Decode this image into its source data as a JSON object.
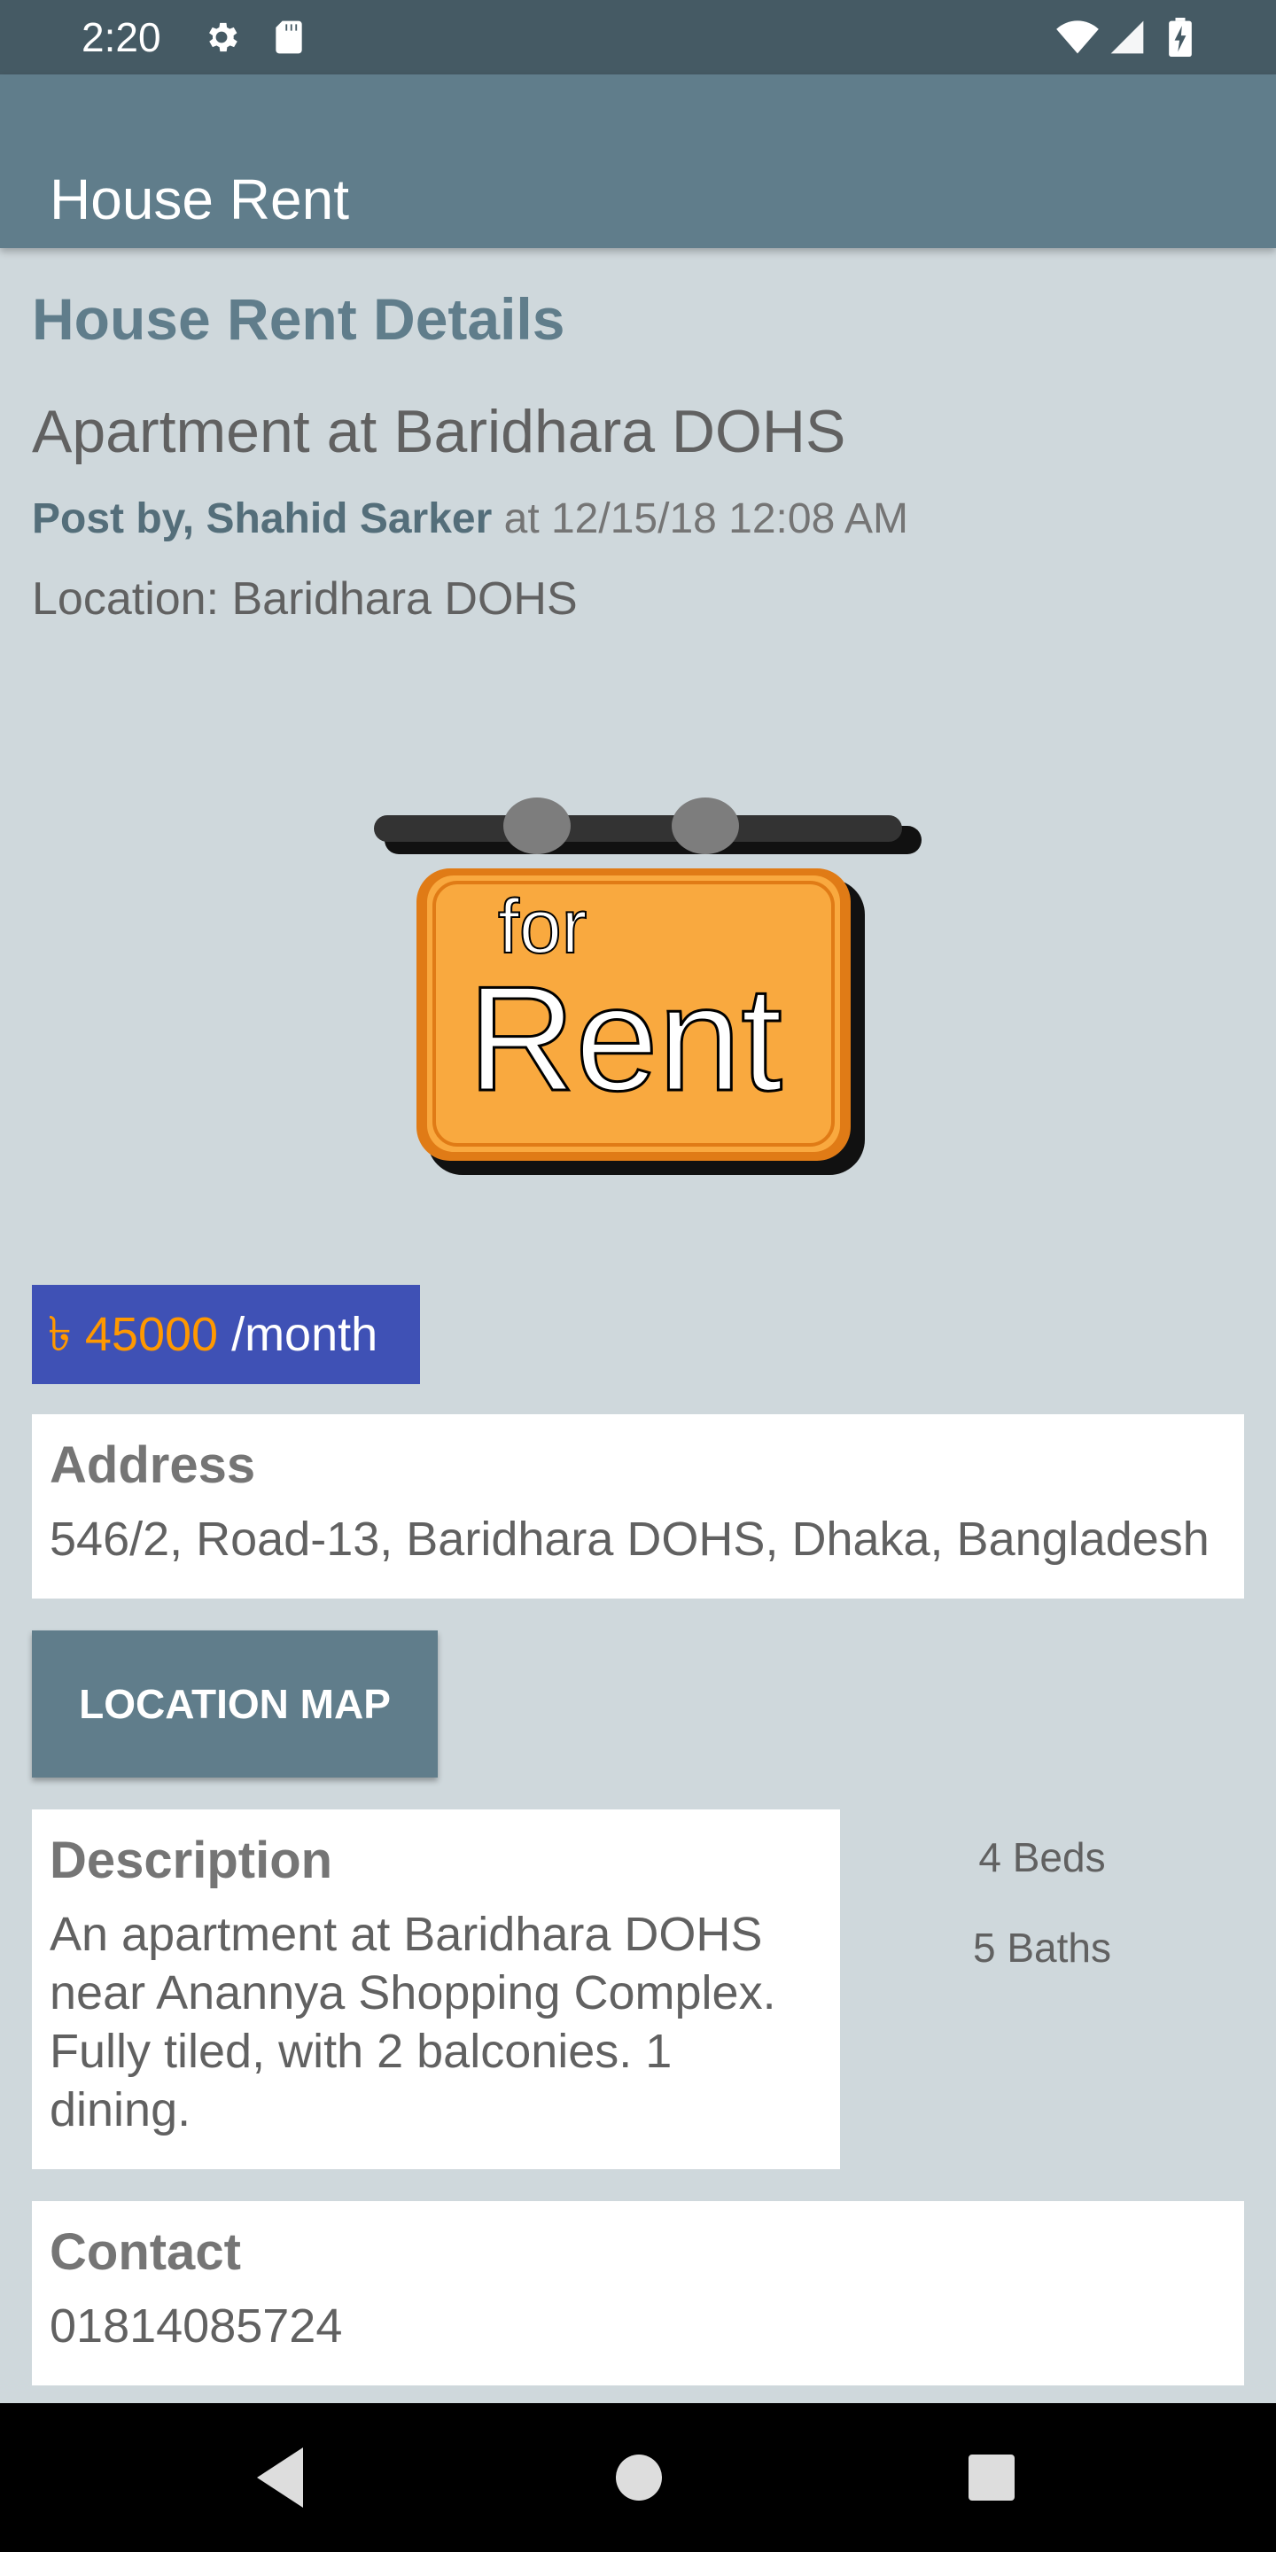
{
  "status_bar": {
    "time": "2:20",
    "icons": [
      "gear-icon",
      "sd-card-icon",
      "wifi-icon",
      "cell-signal-icon",
      "battery-charging-icon"
    ]
  },
  "app_bar": {
    "title": "House Rent"
  },
  "details": {
    "section_title": "House Rent Details",
    "title": "Apartment at Baridhara DOHS",
    "posted_by_label": "Post by, Shahid Sarker",
    "posted_at": " at 12/15/18 12:08 AM",
    "location": "Location: Baridhara DOHS"
  },
  "sign": {
    "line1": "for",
    "line2": "Rent"
  },
  "price": {
    "amount": "৳ 45000",
    "period": " /month"
  },
  "address": {
    "label": "Address",
    "value": "546/2, Road-13, Baridhara DOHS, Dhaka, Bangladesh"
  },
  "map_button": {
    "label": "LOCATION MAP"
  },
  "description": {
    "label": "Description",
    "value": "An apartment at Baridhara DOHS near Anannya Shopping Complex. Fully tiled, with 2 balconies. 1 dining."
  },
  "stats": {
    "beds": "4 Beds",
    "baths": "5 Baths"
  },
  "contact": {
    "label": "Contact",
    "value": "01814085724"
  },
  "nav": {
    "icons": [
      "back-icon",
      "home-icon",
      "recents-icon"
    ]
  },
  "colors": {
    "status_bar": "#455a64",
    "app_bar": "#607d8b",
    "background": "#cfd8dc",
    "price_badge": "#3f51b5",
    "price_amount": "#ff9800",
    "sign_orange": "#f9a93f"
  }
}
